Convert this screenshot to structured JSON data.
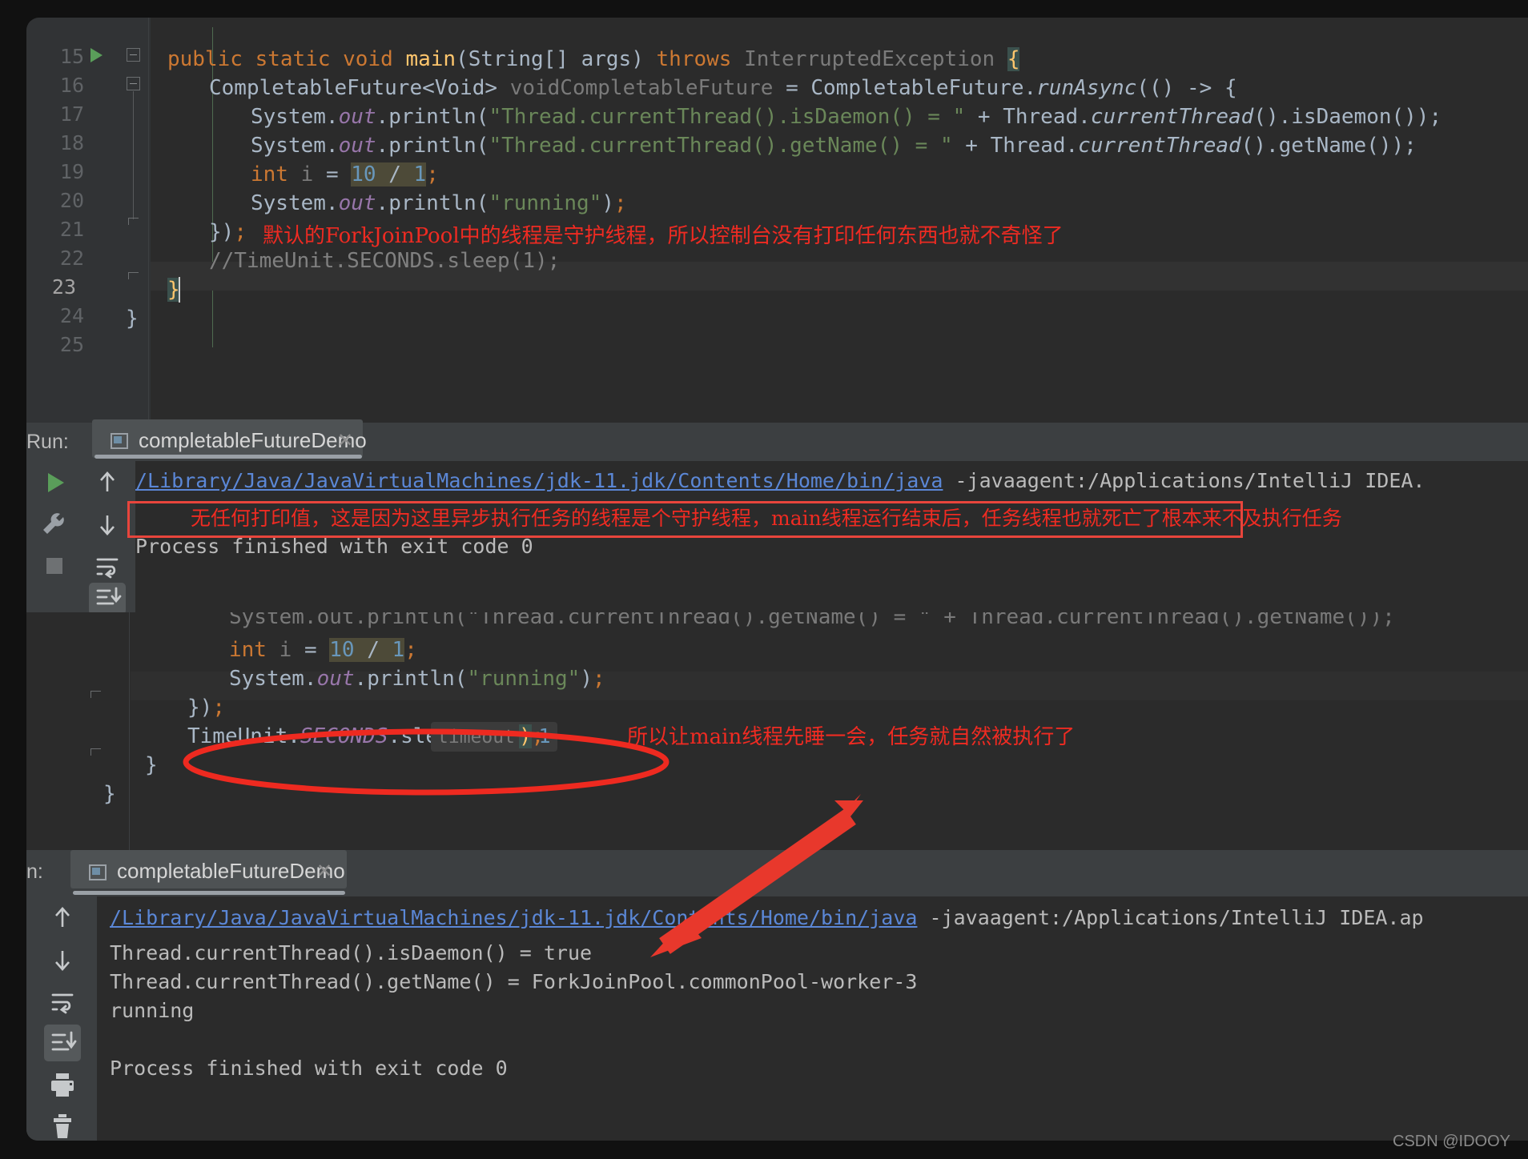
{
  "editor_top": {
    "lines": [
      {
        "num": "15",
        "indent": 0,
        "text": "public static void main(String[] args) throws InterruptedException {"
      },
      {
        "num": "16",
        "indent": 1,
        "text": "CompletableFuture<Void> voidCompletableFuture = CompletableFuture.runAsync(() -> {"
      },
      {
        "num": "17",
        "indent": 2,
        "text": "System.out.println(\"Thread.currentThread().isDaemon() = \" + Thread.currentThread().isDaemon());"
      },
      {
        "num": "18",
        "indent": 2,
        "text": "System.out.println(\"Thread.currentThread().getName() = \" + Thread.currentThread().getName());"
      },
      {
        "num": "19",
        "indent": 2,
        "text": "int i = 10 / 1;"
      },
      {
        "num": "20",
        "indent": 2,
        "text": "System.out.println(\"running\");"
      },
      {
        "num": "21",
        "indent": 1,
        "text": "});"
      },
      {
        "num": "22",
        "indent": 1,
        "text": "//TimeUnit.SECONDS.sleep(1);"
      },
      {
        "num": "23",
        "indent": 0,
        "text": "}"
      },
      {
        "num": "24",
        "indent": 0,
        "text": "}"
      },
      {
        "num": "25",
        "indent": 0,
        "text": ""
      }
    ],
    "annotation": "默认的ForkJoinPool中的线程是守护线程，所以控制台没有打印任何东西也就不奇怪了"
  },
  "run_panel_1": {
    "run_label": "Run:",
    "tab_title": "completableFutureDemo",
    "close_glyph": "✕",
    "console": {
      "command_link": "/Library/Java/JavaVirtualMachines/jdk-11.jdk/Contents/Home/bin/java",
      "command_rest": " -javaagent:/Applications/IntelliJ IDEA.",
      "exit_line": "Process finished with exit code 0"
    },
    "annotation": "无任何打印值，这是因为这里异步执行任务的线程是个守护线程，main线程运行结束后，任务线程也就死亡了根本来不及执行任务",
    "toolbar": [
      {
        "name": "rerun-icon",
        "glyph": "▶"
      },
      {
        "name": "settings-icon",
        "glyph": "🔧"
      },
      {
        "name": "stop-icon",
        "glyph": "■"
      }
    ],
    "toolbar2": [
      {
        "name": "up-arrow-icon",
        "glyph": "↑"
      },
      {
        "name": "down-arrow-icon",
        "glyph": "↓"
      },
      {
        "name": "soft-wrap-icon",
        "glyph": "⏎"
      },
      {
        "name": "scroll-to-end-icon",
        "glyph": "⤓"
      }
    ]
  },
  "editor_mid": {
    "lines": [
      {
        "text": "System.out.println(\"Thread.currentThread().getName() = \" + Thread.currentThread().getName());"
      },
      {
        "text": "int i = 10 / 1;"
      },
      {
        "text": "System.out.println(\"running\");"
      },
      {
        "text": "});"
      },
      {
        "text": "TimeUnit.SECONDS.sleep( timeout: 1);"
      },
      {
        "text": "}"
      },
      {
        "text": "}"
      }
    ],
    "hint_param": "timeout:",
    "hint_value": "1",
    "annotation": "所以让main线程先睡一会，任务就自然被执行了"
  },
  "run_panel_2": {
    "run_label": "n:",
    "tab_title": "completableFutureDemo",
    "close_glyph": "✕",
    "console": {
      "command_link": "/Library/Java/JavaVirtualMachines/jdk-11.jdk/Contents/Home/bin/java",
      "command_rest": " -javaagent:/Applications/IntelliJ IDEA.ap",
      "output": [
        "Thread.currentThread().isDaemon() = true",
        "Thread.currentThread().getName() = ForkJoinPool.commonPool-worker-3",
        "running",
        "",
        "Process finished with exit code 0"
      ]
    },
    "toolbar": [
      {
        "name": "up-arrow-icon",
        "glyph": "↑"
      },
      {
        "name": "down-arrow-icon",
        "glyph": "↓"
      },
      {
        "name": "soft-wrap-icon",
        "glyph": "⏎"
      },
      {
        "name": "scroll-to-end-icon",
        "glyph": "⤓"
      },
      {
        "name": "print-icon",
        "glyph": "🖨"
      },
      {
        "name": "delete-icon",
        "glyph": "🗑"
      }
    ]
  },
  "watermark": "CSDN @IDOOY",
  "colors": {
    "editor_bg": "#2b2b2b",
    "panel_bg": "#3c3f41",
    "gutter_bg": "#313335",
    "annotation_red": "#ef2b22",
    "link_blue": "#5b87d6",
    "keyword_orange": "#cc7832",
    "string_green": "#6a8759",
    "field_purple": "#9876aa",
    "method_yellow": "#ffc66d",
    "number_blue": "#6897bb"
  }
}
